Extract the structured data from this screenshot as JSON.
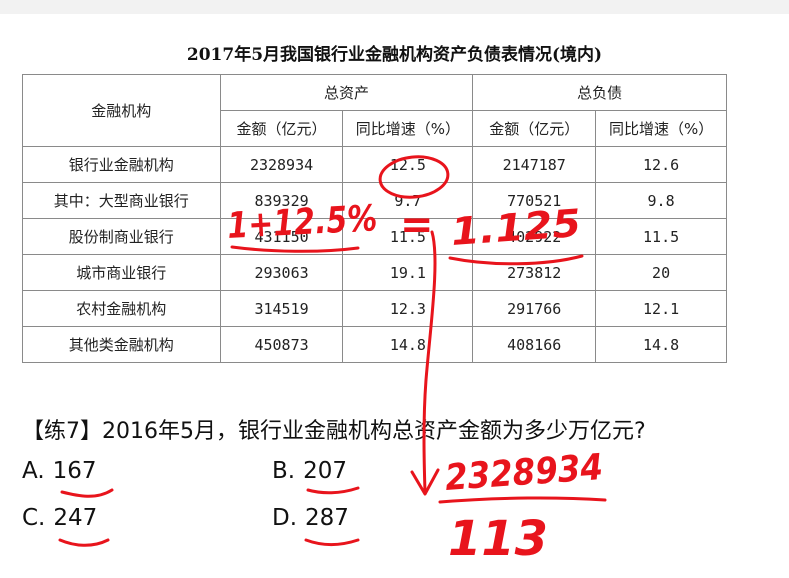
{
  "table": {
    "title": "2017年5月我国银行业金融机构资产负债表情况(境内)",
    "col_institution": "金融机构",
    "group_assets": "总资产",
    "group_liabilities": "总负债",
    "sub_amount": "金额（亿元）",
    "sub_growth": "同比增速（%）",
    "rows": [
      {
        "name": "银行业金融机构",
        "assets": "2328934",
        "assets_growth": "12.5",
        "liab": "2147187",
        "liab_growth": "12.6"
      },
      {
        "name": "其中：大型商业银行",
        "assets": "839329",
        "assets_growth": "9.7",
        "liab": "770521",
        "liab_growth": "9.8"
      },
      {
        "name": "股份制商业银行",
        "assets": "431150",
        "assets_growth": "11.5",
        "liab": "402922",
        "liab_growth": "11.5"
      },
      {
        "name": "城市商业银行",
        "assets": "293063",
        "assets_growth": "19.1",
        "liab": "273812",
        "liab_growth": "20"
      },
      {
        "name": "农村金融机构",
        "assets": "314519",
        "assets_growth": "12.3",
        "liab": "291766",
        "liab_growth": "12.1"
      },
      {
        "name": "其他类金融机构",
        "assets": "450873",
        "assets_growth": "14.8",
        "liab": "408166",
        "liab_growth": "14.8"
      }
    ]
  },
  "question": "【练7】2016年5月，银行业金融机构总资产金额为多少万亿元?",
  "options": [
    {
      "letter": "A.",
      "value": "167"
    },
    {
      "letter": "B.",
      "value": "207"
    },
    {
      "letter": "C.",
      "value": "247"
    },
    {
      "letter": "D.",
      "value": "287"
    }
  ],
  "handwriting": {
    "ink_color": "#e8141c",
    "percent": "1+12.5%",
    "equals": "=",
    "factor": "1.125",
    "numerator": "2328934",
    "denominator": "113"
  }
}
